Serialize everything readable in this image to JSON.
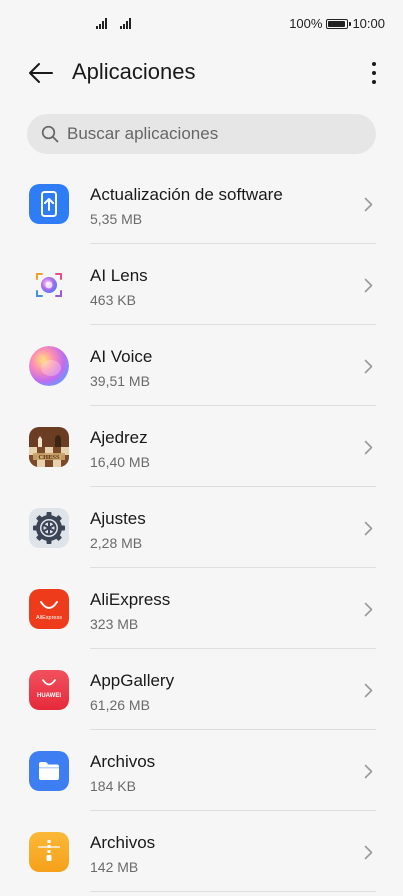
{
  "status_bar": {
    "battery": "100%",
    "time": "10:00",
    "battery_level": 1.0
  },
  "header": {
    "title": "Aplicaciones"
  },
  "search": {
    "placeholder": "Buscar aplicaciones"
  },
  "apps": [
    {
      "name": "Actualización de software",
      "size": "5,35 MB",
      "icon": "software-update-icon"
    },
    {
      "name": "AI Lens",
      "size": "463 KB",
      "icon": "ai-lens-icon"
    },
    {
      "name": "AI Voice",
      "size": "39,51 MB",
      "icon": "ai-voice-icon"
    },
    {
      "name": "Ajedrez",
      "size": "16,40 MB",
      "icon": "chess-icon"
    },
    {
      "name": "Ajustes",
      "size": "2,28 MB",
      "icon": "settings-gear-icon"
    },
    {
      "name": "AliExpress",
      "size": "323 MB",
      "icon": "aliexpress-icon",
      "icon_text": "AliExpress"
    },
    {
      "name": "AppGallery",
      "size": "61,26 MB",
      "icon": "appgallery-icon",
      "icon_text": "HUAWEI"
    },
    {
      "name": "Archivos",
      "size": "184 KB",
      "icon": "folder-icon"
    },
    {
      "name": "Archivos",
      "size": "142 MB",
      "icon": "file-zip-icon"
    }
  ],
  "colors": {
    "background": "#f6f6f6",
    "search_bg": "#e6e6e6",
    "update_blue": "#2f7df6",
    "aliexpress_red": "#ee3b1c",
    "appgallery_red": "#ea3342",
    "files_blue": "#3d7ef2",
    "zip_orange": "#f6a623"
  }
}
